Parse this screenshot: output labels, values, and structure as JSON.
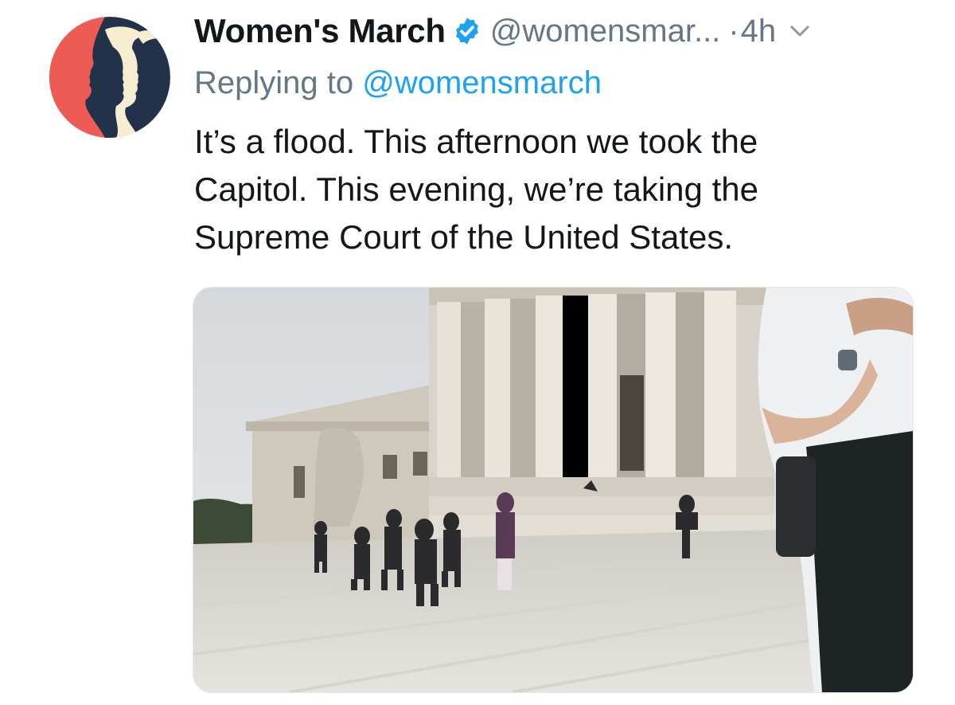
{
  "tweet": {
    "author_name": "Women's March",
    "author_handle": "@womensmar...",
    "verified": true,
    "separator": "·",
    "timestamp": "4h",
    "reply_prefix": "Replying to",
    "reply_to": "@womensmarch",
    "text": "It’s a flood. This afternoon we took the\nCapitol. This evening, we’re taking the\nSupreme Court of the United States."
  },
  "icons": {
    "avatar": "womens-march-logo",
    "verified": "verified-badge-icon",
    "menu": "chevron-down-icon"
  },
  "colors": {
    "link": "#1da1f2",
    "secondary_text": "#657786",
    "primary_text": "#14171a",
    "avatar_bg": "#22324a",
    "avatar_red": "#ee5b55",
    "avatar_cream": "#f6ecd0"
  },
  "media": {
    "type": "video-thumbnail",
    "icon": "video-thumbnail"
  }
}
